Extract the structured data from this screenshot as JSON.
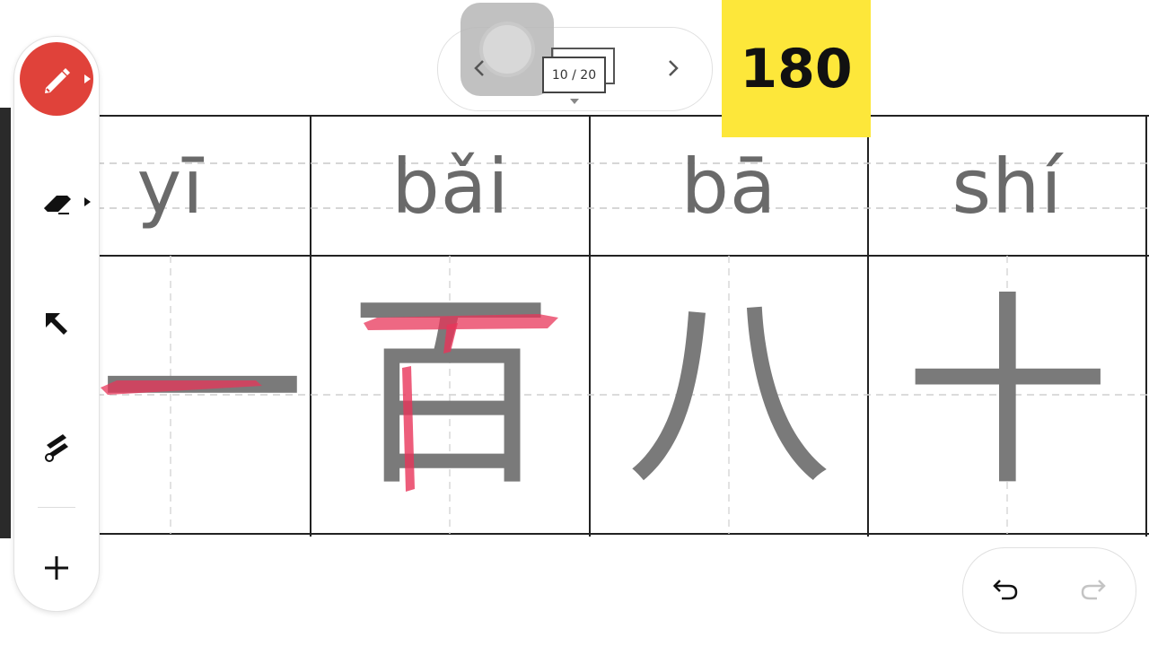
{
  "pager": {
    "current_label": "10 / 20",
    "prev_icon": "chevron-left-icon",
    "next_icon": "chevron-right-icon"
  },
  "counter": {
    "value": "180",
    "color": "#fde73a"
  },
  "toolbar": {
    "tools": [
      {
        "name": "pen",
        "icon": "pen-icon",
        "active": true,
        "color": "#e0423a"
      },
      {
        "name": "eraser",
        "icon": "eraser-icon"
      },
      {
        "name": "select",
        "icon": "arrow-pointer-icon"
      },
      {
        "name": "laser",
        "icon": "laser-pen-icon"
      },
      {
        "name": "add",
        "icon": "plus-icon"
      }
    ]
  },
  "worksheet": {
    "cells": [
      {
        "pinyin": "yī",
        "hanzi": "一"
      },
      {
        "pinyin": "bǎi",
        "hanzi": "百"
      },
      {
        "pinyin": "bā",
        "hanzi": "八"
      },
      {
        "pinyin": "shí",
        "hanzi": "十"
      }
    ],
    "stroke_color": "#e8355a"
  },
  "history": {
    "undo_icon": "undo-icon",
    "redo_icon": "redo-icon"
  }
}
